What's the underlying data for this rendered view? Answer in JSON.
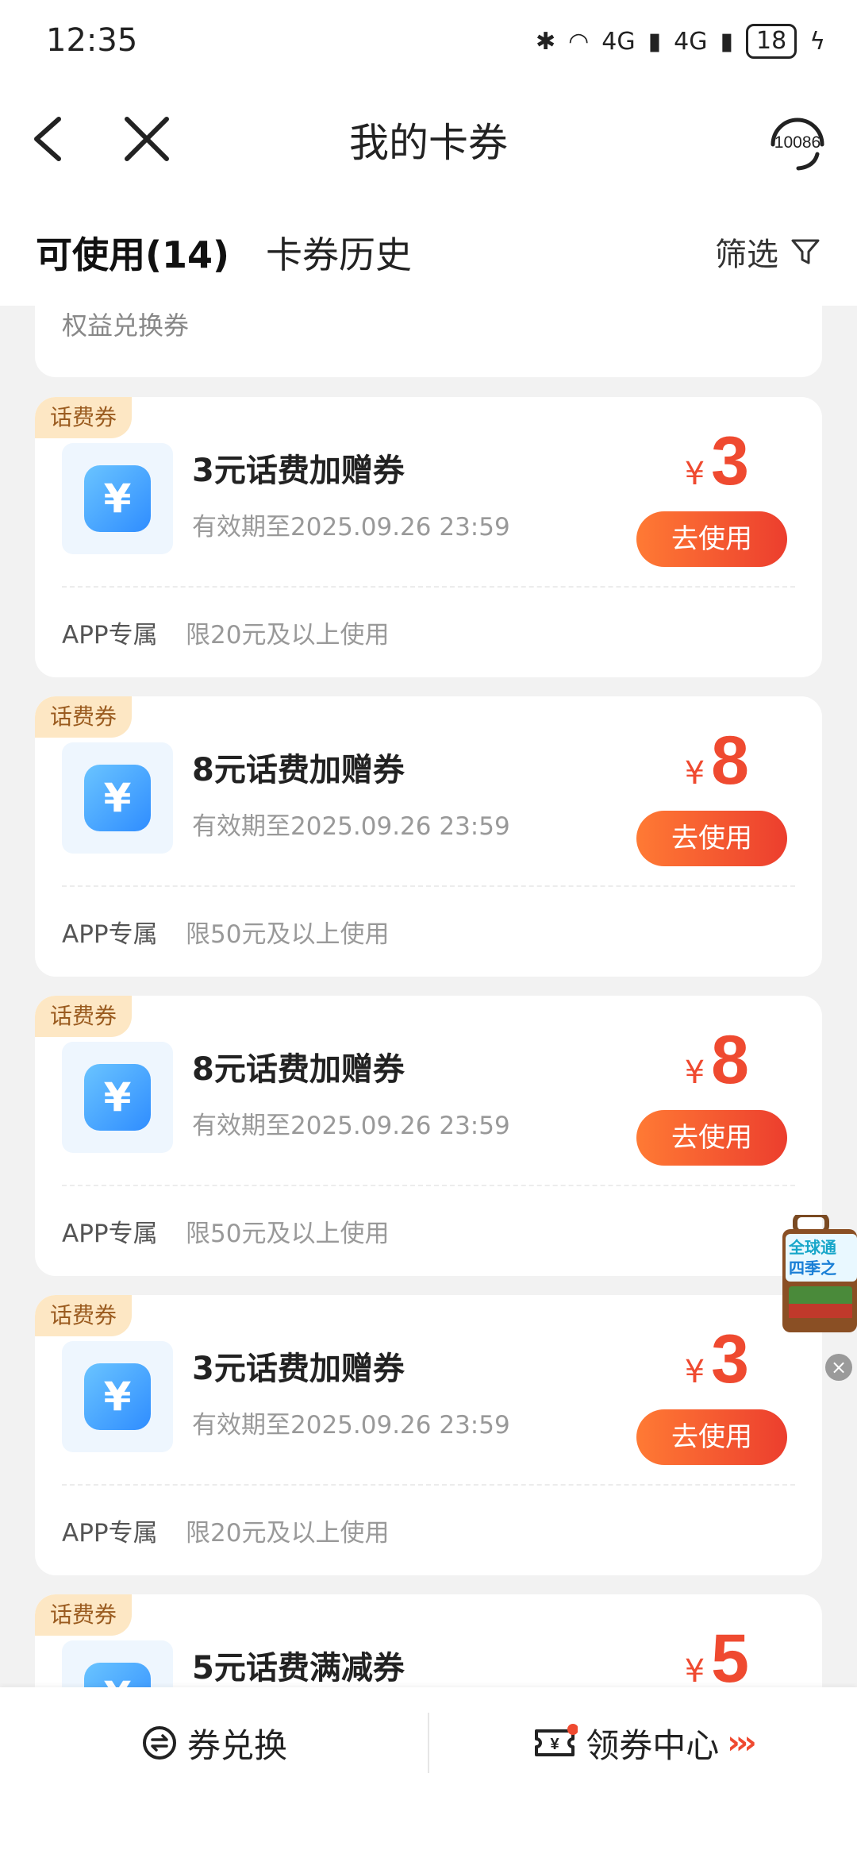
{
  "status": {
    "time": "12:35",
    "signal1": "4G",
    "signal2": "4G",
    "battery": "18"
  },
  "nav": {
    "title": "我的卡券",
    "service_number": "10086"
  },
  "tabs": {
    "active": "可使用(14)",
    "history": "卡券历史",
    "filter": "筛选"
  },
  "prev_card": {
    "label": "权益兑换券"
  },
  "coupons": [
    {
      "tag": "话费券",
      "title": "3元话费加赠券",
      "valid": "有效期至2025.09.26 23:59",
      "price_symbol": "¥",
      "price": "3",
      "button": "去使用",
      "footer_tag": "APP专属",
      "footer_limit": "限20元及以上使用"
    },
    {
      "tag": "话费券",
      "title": "8元话费加赠券",
      "valid": "有效期至2025.09.26 23:59",
      "price_symbol": "¥",
      "price": "8",
      "button": "去使用",
      "footer_tag": "APP专属",
      "footer_limit": "限50元及以上使用"
    },
    {
      "tag": "话费券",
      "title": "8元话费加赠券",
      "valid": "有效期至2025.09.26 23:59",
      "price_symbol": "¥",
      "price": "8",
      "button": "去使用",
      "footer_tag": "APP专属",
      "footer_limit": "限50元及以上使用"
    },
    {
      "tag": "话费券",
      "title": "3元话费加赠券",
      "valid": "有效期至2025.09.26 23:59",
      "price_symbol": "¥",
      "price": "3",
      "button": "去使用",
      "footer_tag": "APP专属",
      "footer_limit": "限20元及以上使用"
    },
    {
      "tag": "话费券",
      "title": "5元话费满减券",
      "valid": "",
      "price_symbol": "¥",
      "price": "5",
      "button": "",
      "footer_tag": "",
      "footer_limit": ""
    }
  ],
  "float_ad": {
    "line1": "全球通",
    "line2": "四季之"
  },
  "bottom": {
    "exchange": "券兑换",
    "center": "领券中心"
  },
  "colors": {
    "accent": "#ef4a30",
    "tag_bg": "#fde7c4",
    "icon_blue": "#2f8dff"
  }
}
